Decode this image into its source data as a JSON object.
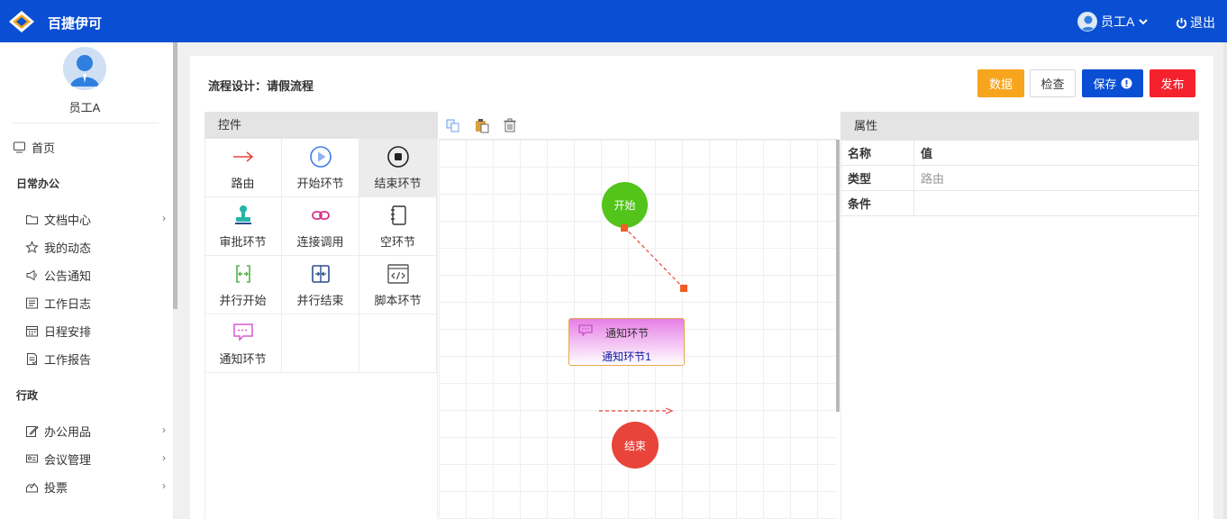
{
  "app": {
    "title": "百捷伊可"
  },
  "topbar": {
    "user_name": "员工A",
    "logout_label": "退出"
  },
  "sidebar": {
    "user_name": "员工A",
    "home": "首页",
    "groups": [
      {
        "label": "日常办公",
        "items": [
          "文档中心",
          "我的动态",
          "公告通知",
          "工作日志",
          "日程安排",
          "工作报告"
        ]
      },
      {
        "label": "行政",
        "items": [
          "办公用品",
          "会议管理",
          "投票"
        ]
      }
    ]
  },
  "page": {
    "title": "流程设计：请假流程"
  },
  "toolbar": {
    "data_label": "数据",
    "check_label": "检查",
    "save_label": "保存",
    "publish_label": "发布"
  },
  "palette": {
    "title": "控件",
    "items": [
      "路由",
      "开始环节",
      "结束环节",
      "审批环节",
      "连接调用",
      "空环节",
      "并行开始",
      "并行结束",
      "脚本环节",
      "通知环节"
    ]
  },
  "canvas": {
    "start_label": "开始",
    "end_label": "结束",
    "notify_node": {
      "type": "通知环节",
      "name": "通知环节1"
    }
  },
  "properties": {
    "title": "属性",
    "header": {
      "key": "名称",
      "value": "值"
    },
    "rows": [
      {
        "key": "类型",
        "value": "路由"
      },
      {
        "key": "条件",
        "value": ""
      }
    ]
  },
  "colors": {
    "primary": "#0a4fd3",
    "warning": "#f7a51c",
    "danger": "#f5222d",
    "start": "#52c41a",
    "end": "#e8443a"
  },
  "icons": [
    "logo-icon",
    "user-avatar-icon",
    "chevron-down-icon",
    "power-icon",
    "monitor-icon",
    "folder-icon",
    "star-icon",
    "megaphone-icon",
    "journal-icon",
    "calendar-icon",
    "report-icon",
    "edit-icon",
    "meeting-icon",
    "vote-icon",
    "chevron-right-icon",
    "copy-icon",
    "paste-icon",
    "trash-icon"
  ]
}
